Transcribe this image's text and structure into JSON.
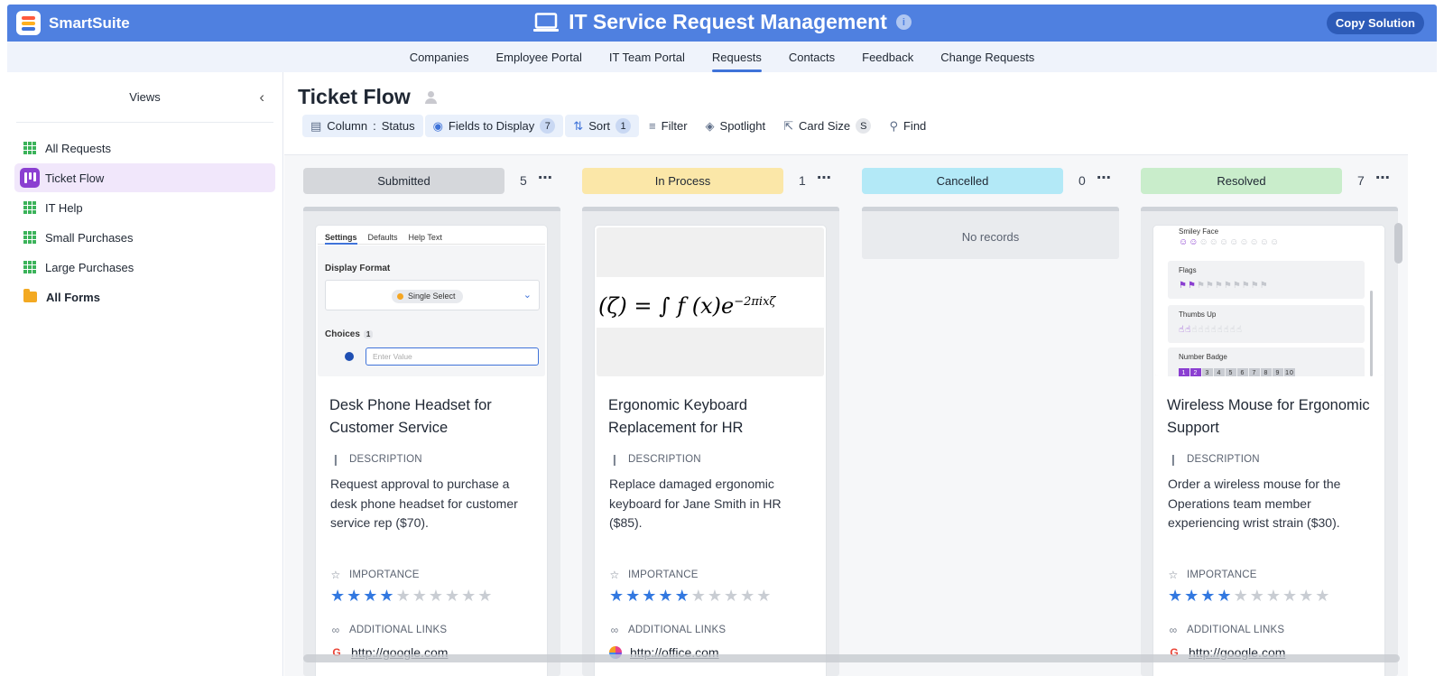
{
  "app": {
    "brand": "SmartSuite",
    "title": "IT Service Request Management",
    "copy_button": "Copy Solution"
  },
  "nav": {
    "tabs": [
      "Companies",
      "Employee Portal",
      "IT Team Portal",
      "Requests",
      "Contacts",
      "Feedback",
      "Change Requests"
    ],
    "active_tab": "Requests"
  },
  "sidebar": {
    "title": "Views",
    "items": [
      {
        "label": "All Requests",
        "icon": "grid-icon"
      },
      {
        "label": "Ticket Flow",
        "icon": "kanban-icon",
        "active": true
      },
      {
        "label": "IT Help",
        "icon": "grid-icon"
      },
      {
        "label": "Small Purchases",
        "icon": "grid-icon"
      },
      {
        "label": "Large Purchases",
        "icon": "grid-icon"
      },
      {
        "label": "All Forms",
        "icon": "folder-icon"
      }
    ]
  },
  "view": {
    "title": "Ticket Flow"
  },
  "toolbar": {
    "column_label": "Column",
    "column_value": "Status",
    "fields_label": "Fields to Display",
    "fields_count": "7",
    "sort_label": "Sort",
    "sort_count": "1",
    "filter_label": "Filter",
    "spotlight_label": "Spotlight",
    "card_size_label": "Card Size",
    "card_size_value": "S",
    "find_label": "Find"
  },
  "columns": [
    {
      "name": "Submitted",
      "count": "5",
      "color": "#d5d7db"
    },
    {
      "name": "In Process",
      "count": "1",
      "color": "#fbe7a8"
    },
    {
      "name": "Cancelled",
      "count": "0",
      "color": "#b3e9f7",
      "empty_text": "No records"
    },
    {
      "name": "Resolved",
      "count": "7",
      "color": "#c9edcb"
    }
  ],
  "field_labels": {
    "description": "DESCRIPTION",
    "importance": "IMPORTANCE",
    "links": "ADDITIONAL LINKS"
  },
  "cards": [
    {
      "title": "Desk Phone Headset for Customer Service",
      "description": "Request approval to purchase a desk phone headset for customer service rep ($70).",
      "importance": 4,
      "importance_max": 10,
      "link": "http://google.com",
      "link_icon": "google-icon",
      "image": {
        "tabs": [
          "Settings",
          "Defaults",
          "Help Text"
        ],
        "display_format_label": "Display Format",
        "selected_format": "Single Select",
        "choices_label": "Choices",
        "choices_count": "1",
        "input_placeholder": "Enter Value"
      }
    },
    {
      "title": "Ergonomic Keyboard Replacement for HR",
      "description": "Replace damaged ergonomic keyboard for Jane Smith in HR ($85).",
      "importance": 5,
      "importance_max": 10,
      "link": "http://office.com",
      "link_icon": "office-icon",
      "image": {
        "formula": "(ζ) = ∫ f (x)e"
      }
    },
    {
      "title": "Wireless Mouse for Ergonomic Support",
      "description": "Order a wireless mouse for the Operations team member experiencing wrist strain ($30).",
      "importance": 4,
      "importance_max": 10,
      "link": "http://google.com",
      "link_icon": "google-icon",
      "image": {
        "rows": [
          "Smiley Face",
          "Flags",
          "Thumbs Up",
          "Number Badge"
        ]
      }
    }
  ]
}
